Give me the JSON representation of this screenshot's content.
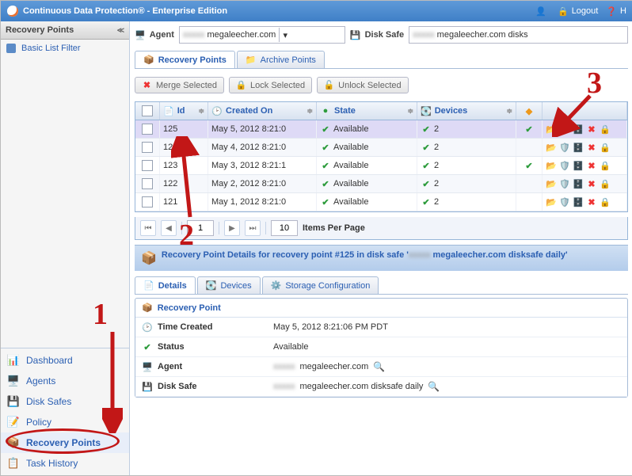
{
  "header": {
    "title": "Continuous Data Protection® - Enterprise Edition",
    "user": "",
    "logout": "Logout",
    "help": "H"
  },
  "sidebar": {
    "title": "Recovery Points",
    "filter": "Basic List Filter",
    "items": [
      {
        "label": "Dashboard"
      },
      {
        "label": "Agents"
      },
      {
        "label": "Disk Safes"
      },
      {
        "label": "Policy"
      },
      {
        "label": "Recovery Points"
      },
      {
        "label": "Task History"
      }
    ]
  },
  "toolbar": {
    "agent_label": "Agent",
    "agent_value": "megaleecher.com",
    "disksafe_label": "Disk Safe",
    "disksafe_value": "megaleecher.com disks"
  },
  "tabs": {
    "recovery": "Recovery Points",
    "archive": "Archive Points"
  },
  "buttons": {
    "merge": "Merge Selected",
    "lock": "Lock Selected",
    "unlock": "Unlock Selected"
  },
  "columns": {
    "id": "Id",
    "created": "Created On",
    "state": "State",
    "devices": "Devices"
  },
  "rows": [
    {
      "id": "125",
      "created": "May 5, 2012 8:21:0",
      "state": "Available",
      "devices": "2",
      "ok": true
    },
    {
      "id": "124",
      "created": "May 4, 2012 8:21:0",
      "state": "Available",
      "devices": "2",
      "ok": false
    },
    {
      "id": "123",
      "created": "May 3, 2012 8:21:1",
      "state": "Available",
      "devices": "2",
      "ok": true
    },
    {
      "id": "122",
      "created": "May 2, 2012 8:21:0",
      "state": "Available",
      "devices": "2",
      "ok": false
    },
    {
      "id": "121",
      "created": "May 1, 2012 8:21:0",
      "state": "Available",
      "devices": "2",
      "ok": false
    }
  ],
  "pager": {
    "page": "1",
    "per": "10",
    "label": "Items Per Page"
  },
  "details": {
    "header_a": "Recovery Point Details for recovery point #125 in disk safe '",
    "header_b": "megaleecher.com disksafe daily'",
    "tabs": {
      "details": "Details",
      "devices": "Devices",
      "storage": "Storage Configuration"
    },
    "title": "Recovery Point",
    "rows": [
      {
        "k": "Time Created",
        "v": "May 5, 2012 8:21:06 PM PDT",
        "icon": "clock",
        "mag": false,
        "blur": false
      },
      {
        "k": "Status",
        "v": "Available",
        "icon": "green",
        "mag": false,
        "blur": false
      },
      {
        "k": "Agent",
        "v": "megaleecher.com",
        "icon": "agent",
        "mag": true,
        "blur": true
      },
      {
        "k": "Disk Safe",
        "v": "megaleecher.com disksafe daily",
        "icon": "disksafe",
        "mag": true,
        "blur": true
      }
    ]
  },
  "annotations": {
    "a1": "1",
    "a2": "2",
    "a3": "3"
  }
}
